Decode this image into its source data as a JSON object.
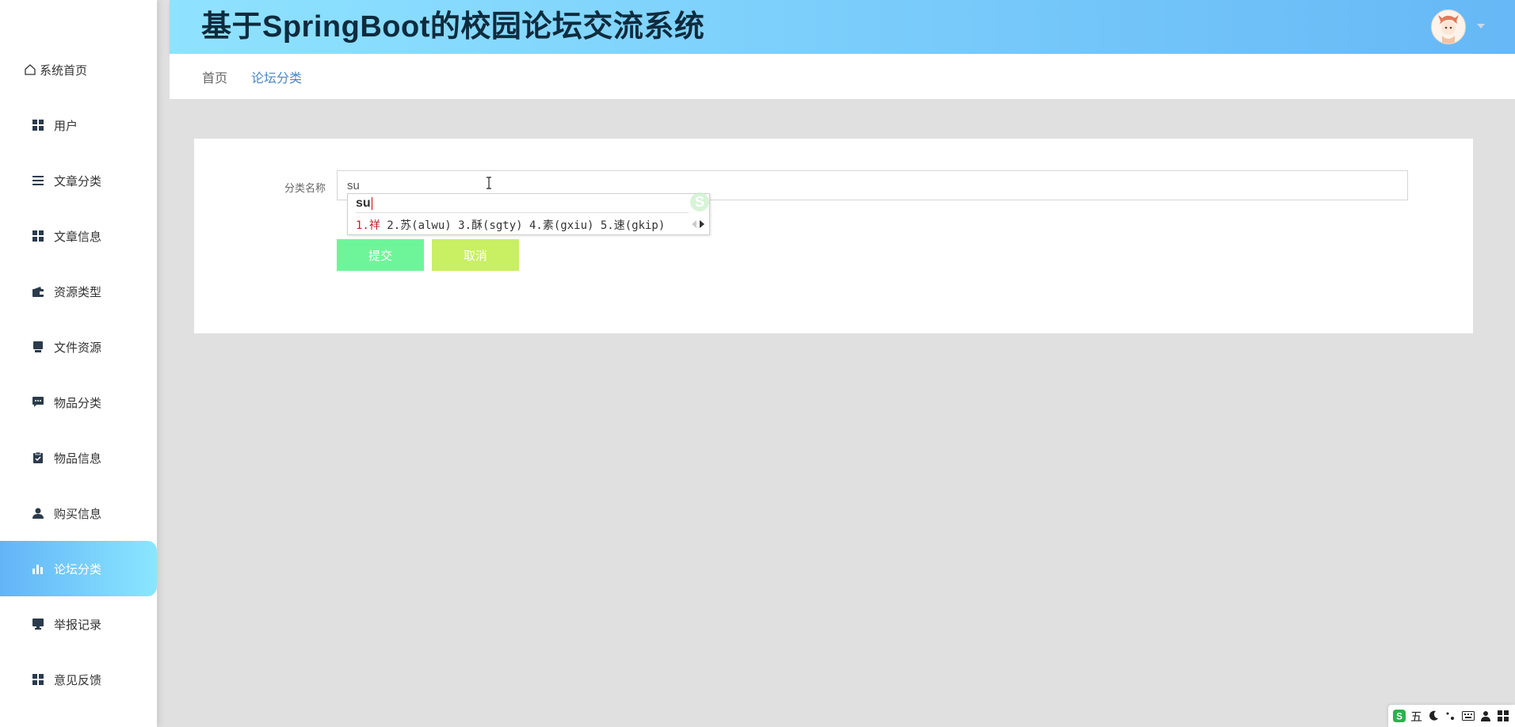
{
  "app": {
    "title": "基于SpringBoot的校园论坛交流系统"
  },
  "sidebar": {
    "items": [
      {
        "label": "系统首页",
        "icon": "home-icon"
      },
      {
        "label": "用户",
        "icon": "grid-icon"
      },
      {
        "label": "文章分类",
        "icon": "list-icon"
      },
      {
        "label": "文章信息",
        "icon": "grid-icon"
      },
      {
        "label": "资源类型",
        "icon": "wallet-icon"
      },
      {
        "label": "文件资源",
        "icon": "drawer-icon"
      },
      {
        "label": "物品分类",
        "icon": "chat-icon"
      },
      {
        "label": "物品信息",
        "icon": "clipboard-icon"
      },
      {
        "label": "购买信息",
        "icon": "user-icon"
      },
      {
        "label": "论坛分类",
        "icon": "bar-chart-icon"
      },
      {
        "label": "举报记录",
        "icon": "monitor-icon"
      },
      {
        "label": "意见反馈",
        "icon": "grid-icon"
      }
    ],
    "active_index": 9
  },
  "breadcrumb": {
    "home": "首页",
    "current": "论坛分类"
  },
  "form": {
    "label": "分类名称",
    "value": "su",
    "submit_label": "提交",
    "cancel_label": "取消"
  },
  "ime": {
    "composition": "su",
    "candidates": "1.祥 2.苏(alwu) 3.酥(sgty) 4.素(gxiu) 5.速(gkip)",
    "first_candidate": "1.祥",
    "rest_candidates": " 2.苏(alwu) 3.酥(sgty) 4.素(gxiu) 5.速(gkip)"
  },
  "ime_bar": {
    "mode": "五"
  },
  "colors": {
    "active_gradient_start": "#62b4f7",
    "active_gradient_end": "#8ae6ff",
    "header_gradient_start": "#8fe3ff",
    "header_gradient_end": "#66b8f6",
    "submit": "#6ef59a",
    "cancel": "#c9ef63",
    "breadcrumb_active": "#4c86c6"
  }
}
